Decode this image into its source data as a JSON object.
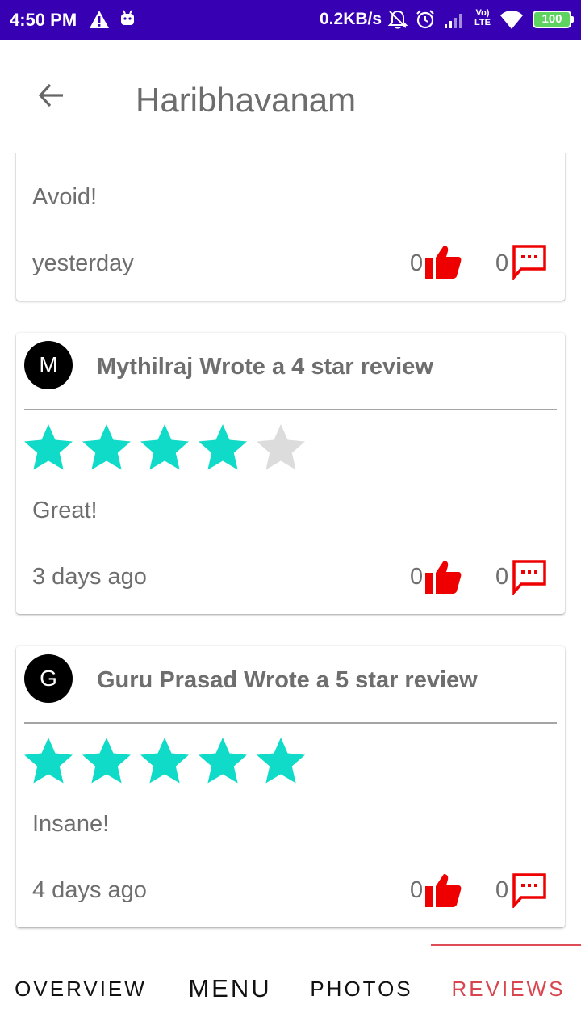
{
  "status_bar": {
    "time": "4:50 PM",
    "network_speed": "0.2KB/s",
    "volte_top": "Vo)",
    "volte_bottom": "LTE",
    "battery": "100",
    "icons": [
      "warning-icon",
      "android-icon",
      "bell-off-icon",
      "alarm-icon",
      "signal-icon",
      "wifi-icon",
      "battery-icon"
    ]
  },
  "app_bar": {
    "title": "Haribhavanam",
    "back_icon": "arrow-back-icon"
  },
  "colors": {
    "status_bar": "#3700b3",
    "star_filled": "#0fdbc8",
    "star_empty": "#dcdcdc",
    "action_red": "#ee0000",
    "tab_active": "#d9454f"
  },
  "reviews": [
    {
      "text": "Avoid!",
      "date": "yesterday",
      "likes": "0",
      "comments": "0"
    },
    {
      "avatar_letter": "M",
      "headline": "Mythilraj Wrote a 4 star review",
      "rating": 4,
      "max_rating": 5,
      "text": "Great!",
      "date": "3 days ago",
      "likes": "0",
      "comments": "0"
    },
    {
      "avatar_letter": "G",
      "headline": "Guru Prasad Wrote a 5 star review",
      "rating": 5,
      "max_rating": 5,
      "text": "Insane!",
      "date": "4 days ago",
      "likes": "0",
      "comments": "0"
    }
  ],
  "tabs": [
    {
      "label": "OVERVIEW",
      "active": false
    },
    {
      "label": "MENU",
      "active": false
    },
    {
      "label": "PHOTOS",
      "active": false
    },
    {
      "label": "REVIEWS",
      "active": true
    }
  ]
}
